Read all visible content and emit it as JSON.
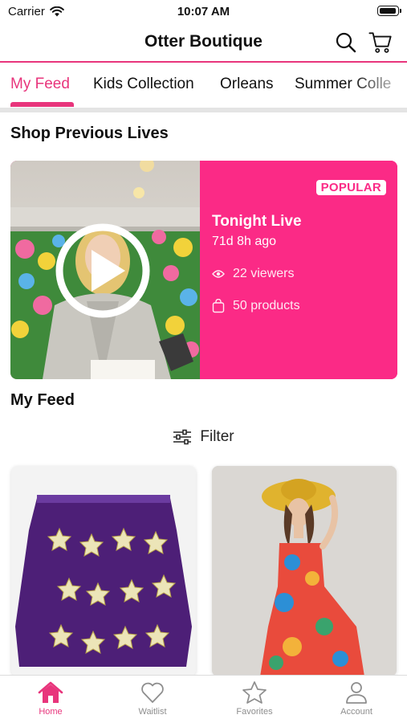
{
  "status_bar": {
    "carrier": "Carrier",
    "time": "10:07 AM"
  },
  "header": {
    "title": "Otter Boutique"
  },
  "tabs": [
    {
      "label": "My Feed",
      "active": true
    },
    {
      "label": "Kids Collection"
    },
    {
      "label": "Orleans"
    },
    {
      "label": "Summer Colle"
    }
  ],
  "previous_lives": {
    "heading": "Shop Previous Lives",
    "card": {
      "badge": "POPULAR",
      "title": "Tonight Live",
      "ago": "71d 8h ago",
      "viewers": "22 viewers",
      "products": "50 products"
    }
  },
  "feed": {
    "heading": "My Feed",
    "filter_label": "Filter"
  },
  "bottom_nav": [
    {
      "label": "Home",
      "icon": "home-icon",
      "active": true
    },
    {
      "label": "Waitlist",
      "icon": "heart-icon"
    },
    {
      "label": "Favorites",
      "icon": "star-icon"
    },
    {
      "label": "Account",
      "icon": "person-icon"
    }
  ],
  "colors": {
    "accent": "#e8357c",
    "live_card": "#fb2a86",
    "inactive": "#8e8e8e"
  }
}
